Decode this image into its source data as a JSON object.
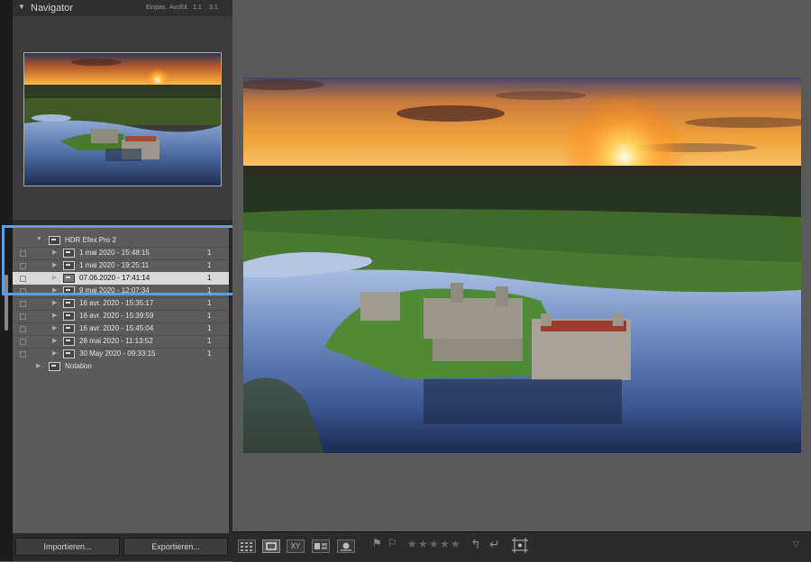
{
  "navigator": {
    "title": "Navigator",
    "zoom_options": [
      "Einpas.",
      "Ausfül.",
      "1:1",
      "3:1"
    ]
  },
  "collections": {
    "parent_label": "HDR Efex Pro 2",
    "rows": [
      {
        "label": "1 mai 2020 - 15:48:15",
        "count": "1"
      },
      {
        "label": "1 mai 2020 - 19:25:11",
        "count": "1"
      },
      {
        "label": "07.06.2020 - 17:41:14",
        "count": "1",
        "selected": true
      },
      {
        "label": "9 mai 2020 - 12:07:34",
        "count": "1"
      },
      {
        "label": "16 avr. 2020 - 15:35:17",
        "count": "1"
      },
      {
        "label": "16 avr. 2020 - 15:39:59",
        "count": "1"
      },
      {
        "label": "16 avr. 2020 - 15:45:04",
        "count": "1"
      },
      {
        "label": "28 mai 2020 - 11:13:52",
        "count": "1"
      },
      {
        "label": "30 May 2020 - 09:33:15",
        "count": "1"
      }
    ],
    "sibling_label": "Notation"
  },
  "buttons": {
    "import_label": "Importieren...",
    "export_label": "Exportieren..."
  },
  "toolbar": {
    "view_survey_label": "XY",
    "rating_stars": 0,
    "rating_max": 5
  },
  "colors": {
    "highlight": "#5c9fe6",
    "panel_bg": "#2a2a2a",
    "main_bg": "#5a5a5a",
    "selected_row": "#d9d9d9"
  }
}
